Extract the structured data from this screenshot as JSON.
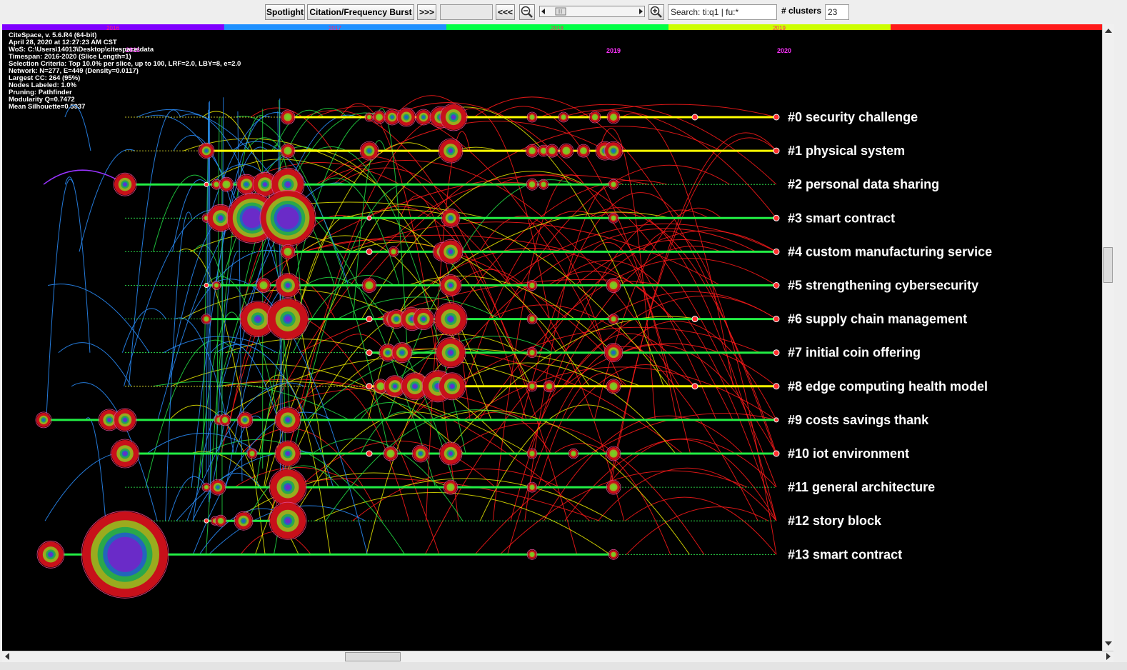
{
  "toolbar": {
    "spotlight": "Spotlight",
    "burst": "Citation/Frequency Burst",
    "forward": ">>>",
    "blank_field": "",
    "back": "<<<",
    "search_value": "Search: ti:q1 | fu:*",
    "clusters_label": "# clusters",
    "clusters_value": "23"
  },
  "colors": {
    "canvas_bg": "#000000",
    "track_green": "#22e04a",
    "track_yellow": "#ffff00",
    "label_text": "#ffffff",
    "info_text": "#ffffff",
    "year_text": "#ff33ff"
  },
  "icons": [
    "zoom-out-icon",
    "zoom-in-icon",
    "scroll-left-icon",
    "scroll-right-icon",
    "scroll-up-icon",
    "scroll-down-icon"
  ],
  "timeline_band": {
    "years": [
      "2016",
      "2017",
      "2018",
      "2019"
    ],
    "colors": [
      "#7f00ff",
      "#1e90ff",
      "#00ff44",
      "#ccff00",
      "#ff1a1a"
    ]
  },
  "year_markers": [
    "2016",
    "2019",
    "2020"
  ],
  "info_lines": [
    "CiteSpace, v. 5.6.R4 (64-bit)",
    "April 28, 2020 at 12:27:23 AM CST",
    "WoS: C:\\Users\\14013\\Desktop\\citespace\\data",
    "Timespan: 2016-2020 (Slice Length=1)",
    "Selection Criteria: Top 10.0% per slice, up to 100, LRF=2.0, LBY=8, e=2.0",
    "Network: N=277, E=449 (Density=0.0117)",
    "Largest CC: 264 (95%)",
    "Nodes Labeled: 1.0%",
    "Pruning: Pathfinder",
    "Modularity Q=0.7472",
    "Mean Silhouette=0.5937"
  ],
  "clusters": [
    {
      "label": "#0 security challenge",
      "highlight": true
    },
    {
      "label": "#1 physical system",
      "highlight": true
    },
    {
      "label": "#2 personal data sharing",
      "highlight": false
    },
    {
      "label": "#3 smart contract",
      "highlight": false
    },
    {
      "label": "#4 custom manufacturing service",
      "highlight": false
    },
    {
      "label": "#5 strengthening cybersecurity",
      "highlight": false
    },
    {
      "label": "#6 supply chain management",
      "highlight": false
    },
    {
      "label": "#7 initial coin offering",
      "highlight": false
    },
    {
      "label": "#8 edge computing health model",
      "highlight": true
    },
    {
      "label": "#9 costs savings thank",
      "highlight": false
    },
    {
      "label": "#10 iot environment",
      "highlight": false
    },
    {
      "label": "#11 general architecture",
      "highlight": false
    },
    {
      "label": "#12 story block",
      "highlight": false
    },
    {
      "label": "#13 smart contract",
      "highlight": false
    }
  ]
}
